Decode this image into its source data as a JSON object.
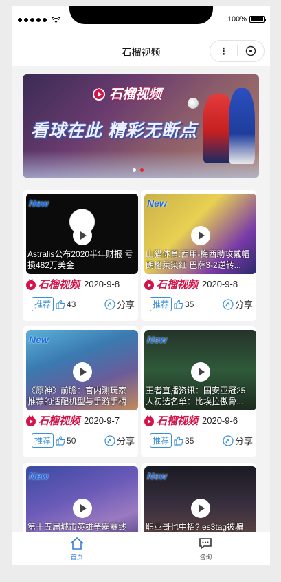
{
  "status_bar": {
    "battery": "100%"
  },
  "nav": {
    "title": "石榴视频",
    "more": "⋮"
  },
  "banner": {
    "logo_text": "石榴视频",
    "slogan": "看球在此 精彩无断点"
  },
  "videos": [
    {
      "badge": "New",
      "caption": "Astralis公布2020半年财报 亏损482万美金",
      "brand": "石榴视频",
      "date": "2020-9-8",
      "tag": "推荐",
      "likes": "43",
      "share": "分享",
      "thumb_colors": [
        "#0b0b0b",
        "#1c1c1c"
      ]
    },
    {
      "badge": "New",
      "caption": "山猫体育:西甲-梅西助攻戴帽 朗格莱染红 巴萨3-2逆转...",
      "brand": "石榴视频",
      "date": "2020-9-8",
      "tag": "推荐",
      "likes": "35",
      "share": "分享",
      "thumb_colors": [
        "#b8a64a",
        "#6a3aa0"
      ]
    },
    {
      "badge": "New",
      "caption": "《原神》前瞻：官内测玩家 推荐的适配机型与手游手柄",
      "brand": "石榴视频",
      "date": "2020-9-7",
      "tag": "推荐",
      "likes": "50",
      "share": "分享",
      "thumb_colors": [
        "#3a8fc0",
        "#6a5c9a"
      ]
    },
    {
      "badge": "New",
      "caption": "王者直播资讯：国安亚冠25 人初选名单：比埃拉傲骨...",
      "brand": "石榴视频",
      "date": "2020-9-6",
      "tag": "推荐",
      "likes": "35",
      "share": "分享",
      "thumb_colors": [
        "#1f3a2a",
        "#2e5a3a"
      ]
    },
    {
      "badge": "New",
      "caption": "第十五届城市英雄争霸赛线",
      "thumb_colors": [
        "#4a3a8a",
        "#7a5ab0"
      ]
    },
    {
      "badge": "New",
      "caption": "职业哥也中招? es3tag被骗",
      "thumb_colors": [
        "#1a1a22",
        "#3a2a30"
      ]
    }
  ],
  "tabbar": [
    {
      "label": "首页",
      "icon": "home-icon",
      "active": true
    },
    {
      "label": "咨询",
      "icon": "chat-icon",
      "active": false
    }
  ]
}
